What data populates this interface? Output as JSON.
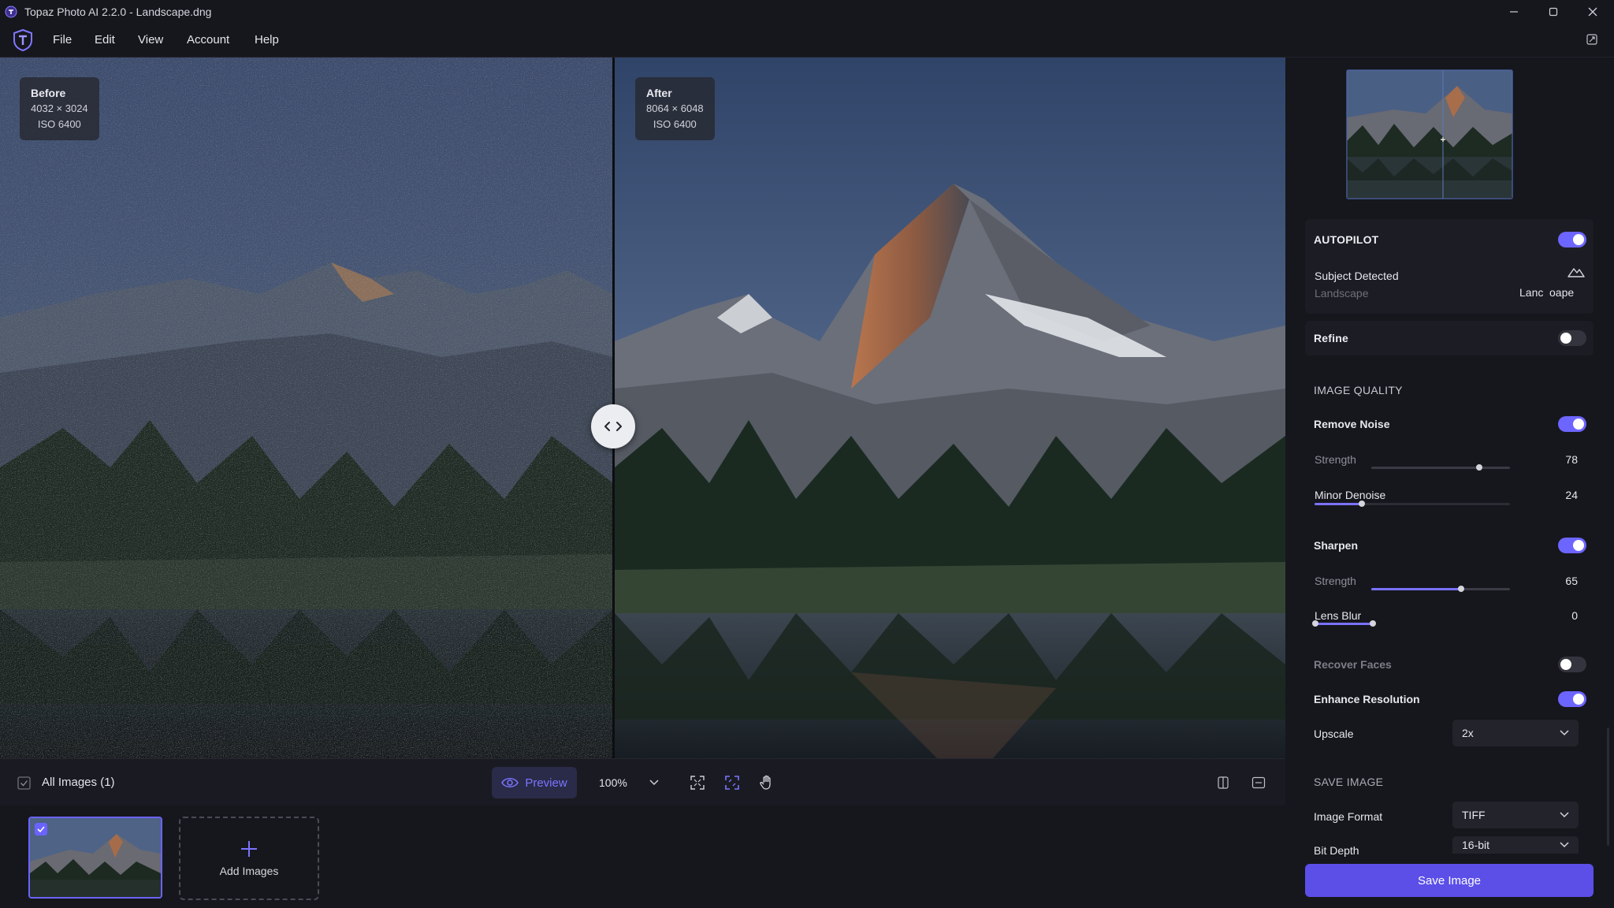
{
  "window": {
    "title": "Topaz Photo AI 2.2.0 - Landscape.dng"
  },
  "menu": [
    "File",
    "Edit",
    "View",
    "Account",
    "Help"
  ],
  "canvas": {
    "before": {
      "title": "Before",
      "dimensions": "4032 × 3024",
      "iso": "ISO 6400"
    },
    "after": {
      "title": "After",
      "dimensions": "8064 × 6048",
      "iso": "ISO 6400"
    }
  },
  "toolbar": {
    "all_images_label": "All Images (1)",
    "preview_label": "Preview",
    "zoom_value": "100%"
  },
  "filmstrip": {
    "add_images_label": "Add Images"
  },
  "panel": {
    "autopilot": {
      "label": "AUTOPILOT",
      "enabled": true
    },
    "subject": {
      "label": "Subject Detected",
      "value": "Landscape",
      "icon_label_left": "Lanc",
      "icon_label_right": "oape"
    },
    "refine": {
      "label": "Refine",
      "enabled": false
    },
    "image_quality_header": "IMAGE QUALITY",
    "remove_noise": {
      "label": "Remove Noise",
      "enabled": true,
      "strength_label": "Strength",
      "strength_value": "78",
      "strength": 78,
      "minor_label": "Minor Denoise",
      "minor_value": "24",
      "minor": 24
    },
    "sharpen": {
      "label": "Sharpen",
      "enabled": true,
      "strength_label": "Strength",
      "strength_value": "65",
      "strength": 65,
      "blur_label": "Lens Blur",
      "blur_value": "0",
      "blur": 0
    },
    "recover_faces": {
      "label": "Recover Faces",
      "enabled": false
    },
    "enhance_resolution": {
      "label": "Enhance Resolution",
      "enabled": true
    },
    "upscale": {
      "label": "Upscale",
      "value": "2x"
    },
    "save_image_header": "SAVE IMAGE",
    "image_format": {
      "label": "Image Format",
      "value": "TIFF"
    },
    "bit_depth": {
      "label": "Bit Depth",
      "value": "16-bit"
    },
    "save_button": "Save Image"
  },
  "colors": {
    "accent": "#6d65ff",
    "save_button": "#5b4fe8",
    "background": "#16171d"
  },
  "icons": [
    "topaz-logo-icon",
    "minimize-icon",
    "maximize-icon",
    "close-icon",
    "restore-icon",
    "split-handle-icon",
    "checkbox-icon",
    "eye-icon",
    "chevron-down-icon",
    "fit-screen-icon",
    "crop-icon",
    "hand-icon",
    "compare-icon",
    "panel-icon",
    "plus-icon",
    "mountain-icon"
  ]
}
